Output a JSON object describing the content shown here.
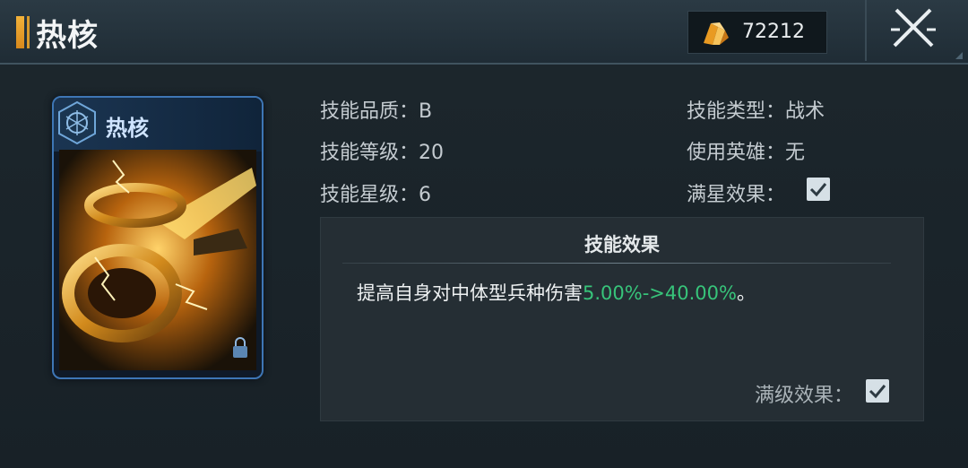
{
  "header": {
    "title": "热核",
    "currency_value": "72212"
  },
  "card": {
    "name": "热核"
  },
  "info": {
    "quality_label": "技能品质：",
    "quality_value": "B",
    "level_label": "技能等级：",
    "level_value": "20",
    "star_label": "技能星级：",
    "star_value": "6",
    "type_label": "技能类型：",
    "type_value": "战术",
    "hero_label": "使用英雄：",
    "hero_value": "无",
    "fullstar_label": "满星效果："
  },
  "effect": {
    "title": "技能效果",
    "text_prefix": "提高自身对中体型兵种伤害",
    "text_value": "5.00%->40.00%",
    "text_suffix": "。",
    "maxlevel_label": "满级效果："
  },
  "colors": {
    "accent_orange": "#f2b23a",
    "value_green": "#37c47a",
    "card_border": "#3e76b5"
  },
  "icons": [
    "crystal-icon",
    "close-icon",
    "emblem-icon",
    "lock-icon",
    "check-icon"
  ]
}
